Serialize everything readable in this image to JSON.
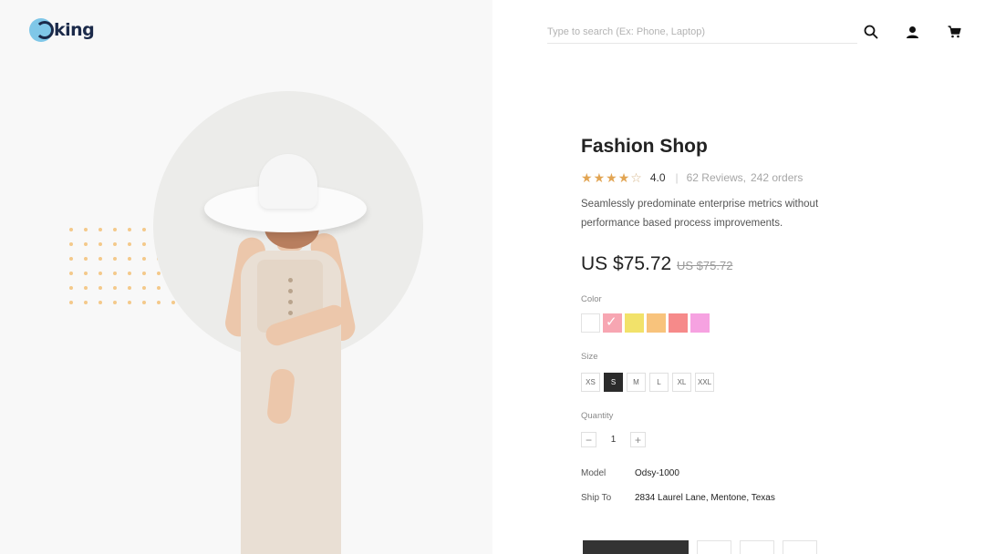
{
  "brand": {
    "logo_text": "king"
  },
  "header": {
    "search_placeholder": "Type to search (Ex: Phone, Laptop)",
    "icons": [
      "search-icon",
      "user-icon",
      "cart-icon"
    ]
  },
  "product": {
    "title": "Fashion Shop",
    "rating": 4,
    "rating_value": "4.0",
    "separator": "|",
    "reviews": "62 Reviews,",
    "orders": "242 orders",
    "description": "Seamlessly predominate enterprise metrics without performance based process improvements.",
    "price": "US $75.72",
    "old_price": "US $75.72",
    "color_label": "Color",
    "colors": [
      {
        "name": "white",
        "hex": "#ffffff"
      },
      {
        "name": "pink",
        "hex": "#f7a6b2",
        "selected": true
      },
      {
        "name": "yellow",
        "hex": "#f2e26a"
      },
      {
        "name": "orange",
        "hex": "#f8c37c"
      },
      {
        "name": "coral",
        "hex": "#f68a8a"
      },
      {
        "name": "violet",
        "hex": "#f6a2e1"
      }
    ],
    "size_label": "Size",
    "sizes": [
      "XS",
      "S",
      "M",
      "L",
      "XL",
      "XXL"
    ],
    "selected_size": "S",
    "quantity_label": "Quantity",
    "quantity": "1",
    "qty_minus": "−",
    "qty_plus": "+",
    "model_label": "Model",
    "model_value": "Odsy-1000",
    "ship_label": "Ship To",
    "ship_value": "2834  Laurel Lane, Mentone, Texas"
  },
  "theme": {
    "accent_star": "#e2a553",
    "dots": "#f4c98a",
    "logo_circle": "#7fc7e8",
    "logo_text": "#1b2a4a"
  }
}
